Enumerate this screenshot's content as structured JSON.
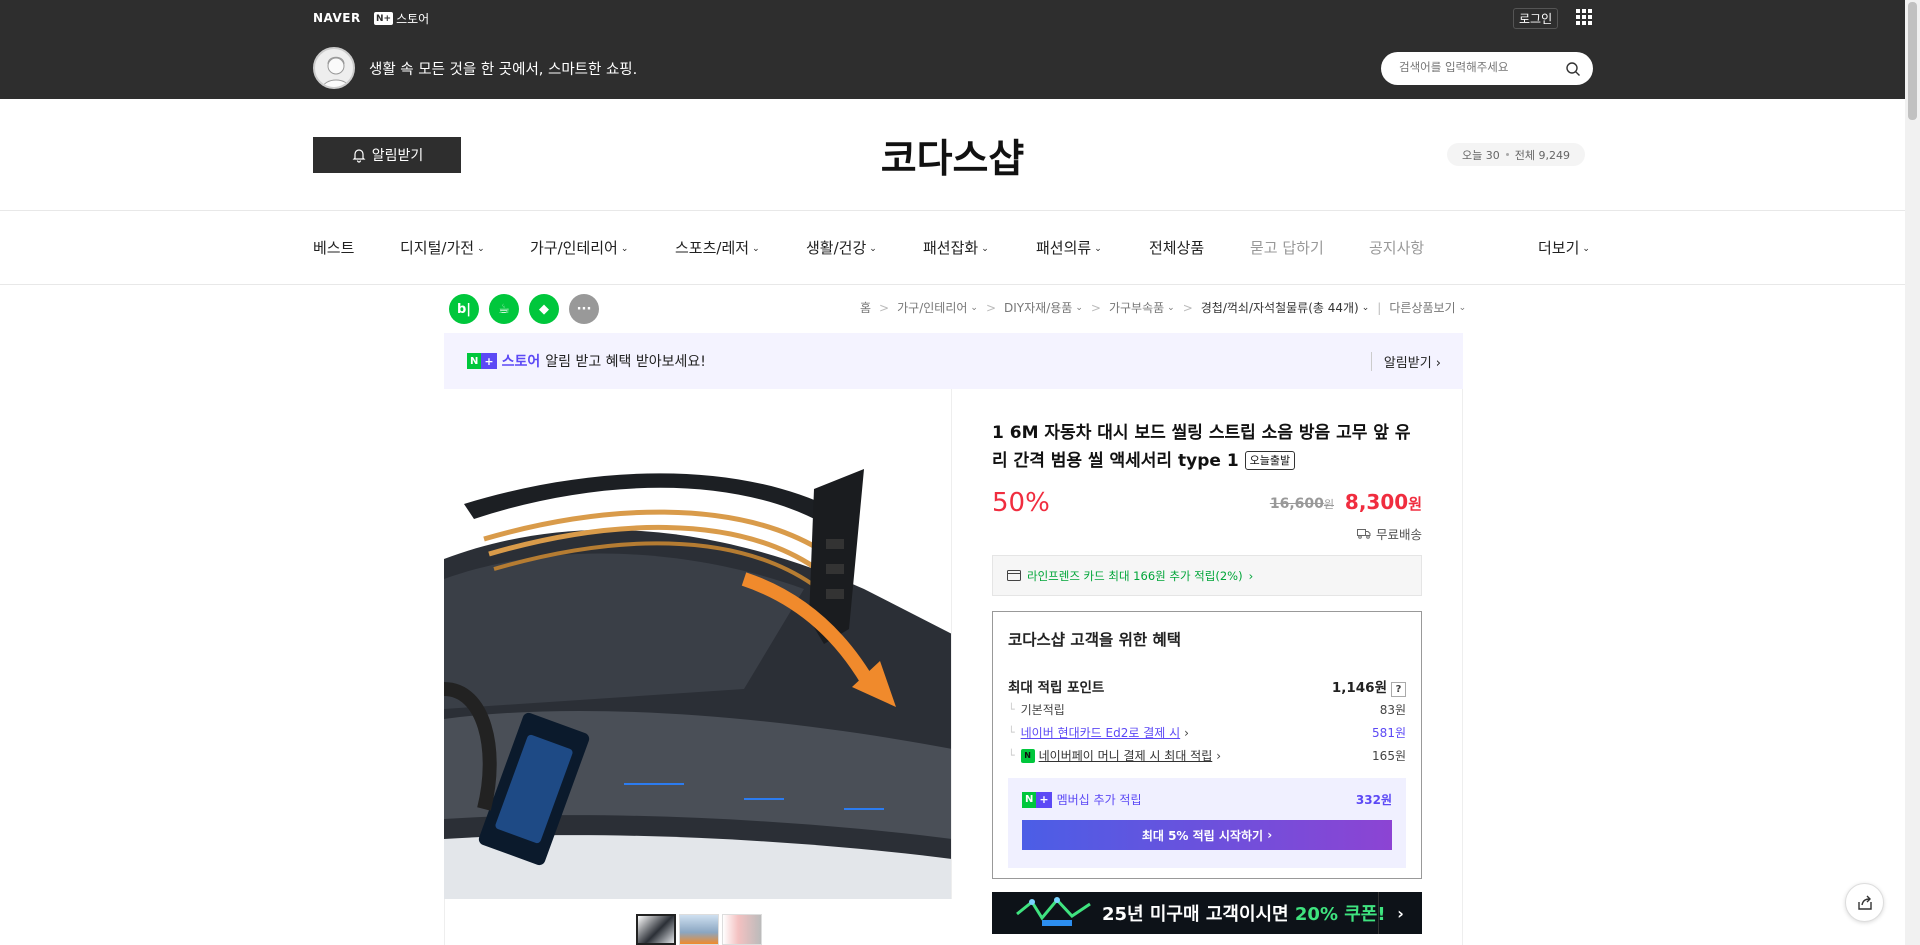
{
  "topbar": {
    "naver_logo": "NAVER",
    "store_badge": "N+",
    "store_label": "스토어",
    "login": "로그인",
    "slogan": "생활 속 모든 것을 한 곳에서, 스마트한 쇼핑.",
    "search_placeholder": "검색어를 입력해주세요"
  },
  "store": {
    "notify_label": "알림받기",
    "name": "코다스샵",
    "visitors_today": "오늘 30",
    "visitors_total": "전체 9,249"
  },
  "nav": {
    "items": [
      {
        "label": "베스트"
      },
      {
        "label": "디지털/가전"
      },
      {
        "label": "가구/인테리어"
      },
      {
        "label": "스포츠/레저"
      },
      {
        "label": "생활/건강"
      },
      {
        "label": "패션잡화"
      },
      {
        "label": "패션의류"
      },
      {
        "label": "전체상품"
      },
      {
        "label": "묻고 답하기"
      },
      {
        "label": "공지사항"
      },
      {
        "label": "더보기"
      }
    ]
  },
  "share": {
    "blog": "b|",
    "cafe": "☕",
    "bookmark": "◆",
    "more": "···"
  },
  "breadcrumb": {
    "items": [
      "홈",
      "가구/인테리어",
      "DIY자재/용품",
      "가구부속품",
      "경첩/꺽쇠/자석철물류(총 44개)",
      "다른상품보기"
    ]
  },
  "notice": {
    "badge_n": "N",
    "badge_plus": "+",
    "store_word": "스토어",
    "text": "알림 받고 혜택 받아보세요!",
    "action": "알림받기"
  },
  "product": {
    "title": "1 6M 자동차 대시 보드 씰링 스트립 소음 방음 고무 앞 유리 간격 범용 씰 액세서리 type 1",
    "badge": "오늘출발",
    "discount": "50%",
    "original_price": "16,600",
    "original_unit": "원",
    "sale_price": "8,300",
    "sale_unit": "원",
    "shipping": "무료배송",
    "card_benefit": "라인프렌즈 카드 최대 166원 추가 적립(2%)",
    "gallery_images": [
      "image_0",
      "image_1",
      "image_2"
    ]
  },
  "benefit": {
    "title": "코다스샵 고객을 위한 혜택",
    "max_point_label": "최대 적립 포인트",
    "max_point_value": "1,146원",
    "q_mark": "?",
    "basic_label": "기본적립",
    "basic_value": "83원",
    "hyundai_label": "네이버 현대카드 Ed2로 결제 시",
    "hyundai_value": "581원",
    "npay_icon": "N",
    "npay_label": "네이버페이 머니 결제 시 최대 적립",
    "npay_value": "165원",
    "membership_label": "멤버십 추가 적립",
    "membership_value": "332원",
    "membership_btn": "최대 5% 적립 시작하기"
  },
  "banner": {
    "text_main": "25년 미구매 고객이시면 ",
    "text_highlight": "20% 쿠폰!",
    "arrow": "›"
  },
  "colors": {
    "accent_red": "#f02d3f",
    "naver_green": "#00c73c",
    "plus_purple": "#5c49f5",
    "dark_header": "#2e2e2e"
  }
}
